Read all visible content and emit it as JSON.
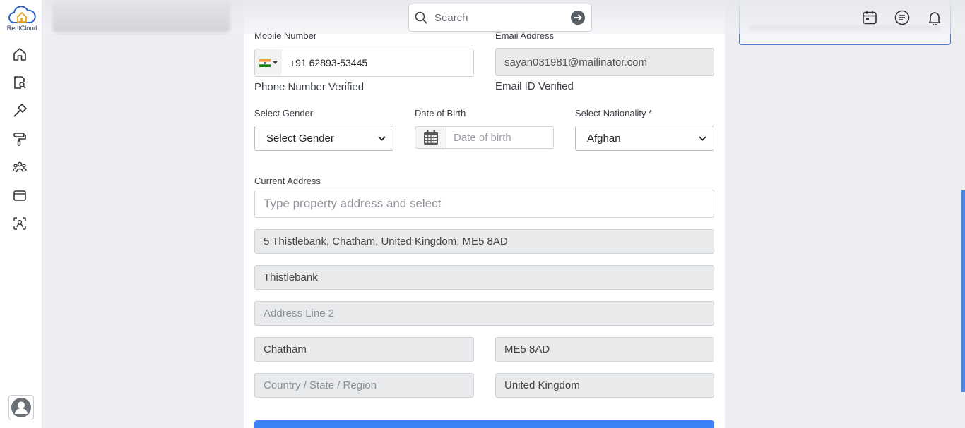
{
  "app": {
    "logo_text": "RentCloud"
  },
  "sidebar": {
    "items": [
      {
        "icon": "home-icon"
      },
      {
        "icon": "document-search-icon"
      },
      {
        "icon": "hammer-icon"
      },
      {
        "icon": "paint-roller-icon"
      },
      {
        "icon": "users-icon"
      },
      {
        "icon": "wallet-icon"
      },
      {
        "icon": "face-scan-icon"
      }
    ]
  },
  "topbar": {
    "search_placeholder": "Search"
  },
  "form": {
    "mobile_label": "Mobile Number",
    "phone_value": "+91 62893-53445",
    "phone_verified": "Phone Number Verified",
    "email_label": "Email Address",
    "email_value": "sayan031981@mailinator.com",
    "email_verified": "Email ID Verified",
    "gender_label": "Select Gender",
    "gender_value": "Select Gender",
    "dob_label": "Date of Birth",
    "dob_placeholder": "Date of birth",
    "nationality_label": "Select Nationality *",
    "nationality_value": "Afghan",
    "address_label": "Current Address",
    "address_placeholder": "Type property address and select",
    "address_full": "5  Thistlebank, Chatham, United Kingdom, ME5 8AD",
    "address_line1": "Thistlebank",
    "address_line2_placeholder": "Address Line 2",
    "city": "Chatham",
    "postcode": "ME5 8AD",
    "region_placeholder": "Country / State / Region",
    "country": "United Kingdom"
  },
  "colors": {
    "accent": "#3b82f6",
    "sidebar_bg": "#ffffff",
    "readonly_bg": "#e9eaec"
  }
}
